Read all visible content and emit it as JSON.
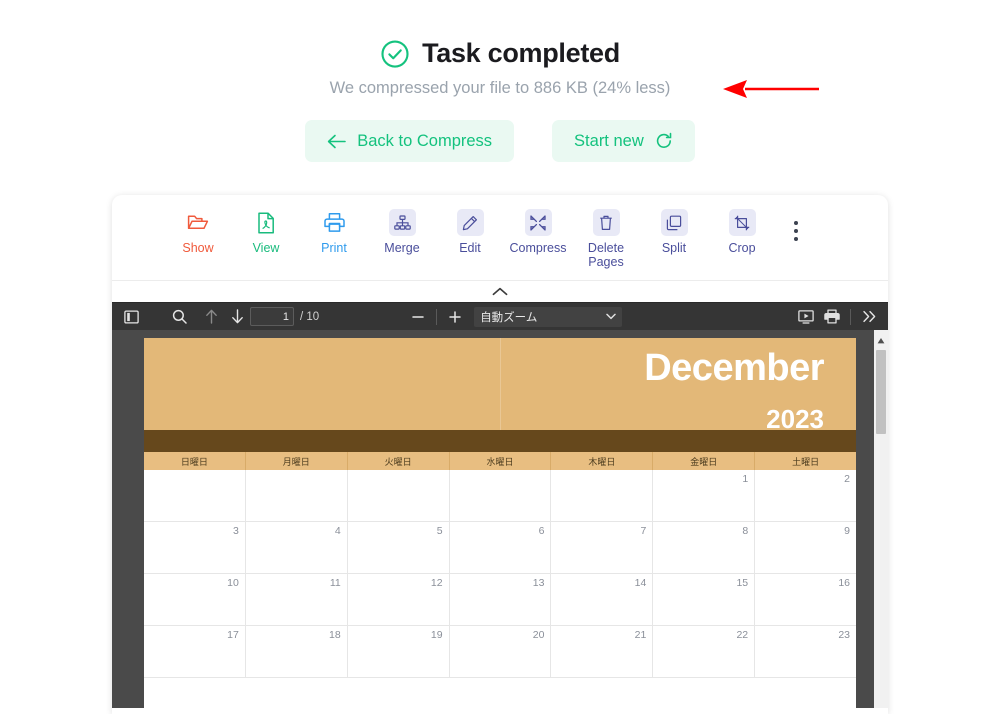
{
  "result": {
    "status_icon": "check-circle-icon",
    "title": "Task completed",
    "subtitle": "We compressed your file to 886 KB (24% less)",
    "file_size": "886 KB",
    "reduction": "24% less",
    "annotation_icon": "red-left-arrow",
    "accent_color": "#14c27e",
    "annotation_color": "#ff0000"
  },
  "actions": {
    "back_icon": "arrow-left-icon",
    "back_label": "Back to Compress",
    "start_label": "Start new",
    "start_icon": "refresh-icon"
  },
  "toolbar": {
    "tools": [
      {
        "label": "Show",
        "icon": "open-folder-icon",
        "color": "#f05a3c",
        "badge": false
      },
      {
        "label": "View",
        "icon": "pdf-file-icon",
        "color": "#19bb7d",
        "badge": false
      },
      {
        "label": "Print",
        "icon": "printer-icon",
        "color": "#2f9bed",
        "badge": false
      },
      {
        "label": "Merge",
        "icon": "merge-nodes-icon",
        "color": "#4a4e9b",
        "badge": true
      },
      {
        "label": "Edit",
        "icon": "pencil-icon",
        "color": "#4a4e9b",
        "badge": true
      },
      {
        "label": "Compress",
        "icon": "compress-icon",
        "color": "#4a4e9b",
        "badge": true
      },
      {
        "label": "Delete Pages",
        "icon": "trash-icon",
        "color": "#4a4e9b",
        "badge": true
      },
      {
        "label": "Split",
        "icon": "split-pages-icon",
        "color": "#4a4e9b",
        "badge": true
      },
      {
        "label": "Crop",
        "icon": "crop-icon",
        "color": "#4a4e9b",
        "badge": true
      }
    ],
    "more_icon": "kebab-menu-icon",
    "collapse_icon": "chevron-up-icon"
  },
  "viewer": {
    "sidebar_toggle_icon": "sidebar-toggle-icon",
    "search_icon": "search-icon",
    "prev_icon": "arrow-up-icon",
    "next_icon": "arrow-down-icon",
    "page_number": "1",
    "page_total": "/ 10",
    "zoom_out_icon": "minus-icon",
    "zoom_in_icon": "plus-icon",
    "zoom_value": "自動ズーム",
    "zoom_caret_icon": "chevron-down-icon",
    "presentation_icon": "presentation-mode-icon",
    "print_icon": "printer-icon",
    "more_tools_icon": "double-chevron-right-icon",
    "toolbar_bg": "#353535"
  },
  "document": {
    "month": "December",
    "year": "2023",
    "banner_color": "#e3b878",
    "bar_color": "#66481c",
    "weekdays": [
      "日曜日",
      "月曜日",
      "火曜日",
      "水曜日",
      "木曜日",
      "金曜日",
      "土曜日"
    ],
    "weeks": [
      [
        "",
        "",
        "",
        "",
        "",
        "1",
        "2"
      ],
      [
        "3",
        "4",
        "5",
        "6",
        "7",
        "8",
        "9"
      ],
      [
        "10",
        "11",
        "12",
        "13",
        "14",
        "15",
        "16"
      ],
      [
        "17",
        "18",
        "19",
        "20",
        "21",
        "22",
        "23"
      ]
    ]
  }
}
